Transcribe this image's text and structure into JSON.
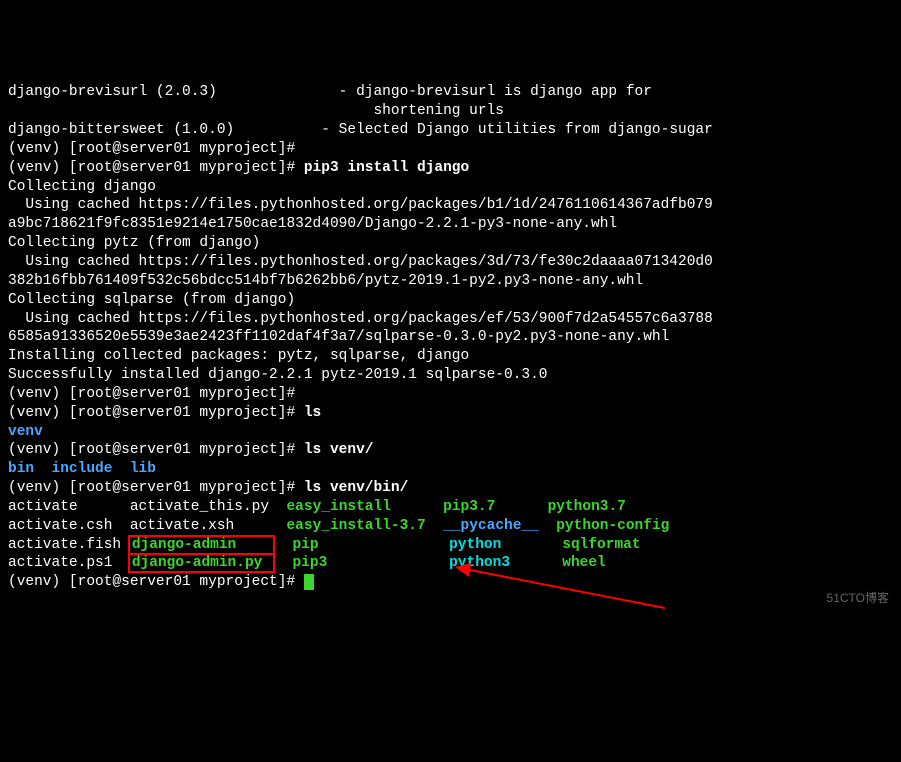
{
  "lines": {
    "l1_a": "django-brevisurl (2.0.3)",
    "l1_b": "- django-brevisurl is django app for",
    "l2": "                                          shortening urls",
    "l3_a": "django-bittersweet (1.0.0)",
    "l3_b": "- Selected Django utilities from django-sugar",
    "l4": "(venv) [root@server01 myproject]#",
    "l5_p": "(venv) [root@server01 myproject]# ",
    "l5_c": "pip3 install django",
    "l6": "Collecting django",
    "l7": "  Using cached https://files.pythonhosted.org/packages/b1/1d/2476110614367adfb079",
    "l8": "a9bc718621f9fc8351e9214e1750cae1832d4090/Django-2.2.1-py3-none-any.whl",
    "l9": "Collecting pytz (from django)",
    "l10": "  Using cached https://files.pythonhosted.org/packages/3d/73/fe30c2daaaa0713420d0",
    "l11": "382b16fbb761409f532c56bdcc514bf7b6262bb6/pytz-2019.1-py2.py3-none-any.whl",
    "l12": "Collecting sqlparse (from django)",
    "l13": "  Using cached https://files.pythonhosted.org/packages/ef/53/900f7d2a54557c6a3788",
    "l14": "6585a91336520e5539e3ae2423ff1102daf4f3a7/sqlparse-0.3.0-py2.py3-none-any.whl",
    "l15": "Installing collected packages: pytz, sqlparse, django",
    "l16": "Successfully installed django-2.2.1 pytz-2019.1 sqlparse-0.3.0",
    "l17": "(venv) [root@server01 myproject]#",
    "l18_p": "(venv) [root@server01 myproject]# ",
    "l18_c": "ls",
    "l19": "venv",
    "l20_p": "(venv) [root@server01 myproject]# ",
    "l20_c": "ls venv/",
    "l21_a": "bin",
    "l21_b": "include",
    "l21_c": "lib",
    "l22_p": "(venv) [root@server01 myproject]# ",
    "l22_c": "ls venv/bin/",
    "tbl": {
      "r1c1": "activate",
      "r1c2": "activate_this.py",
      "r1c3": "easy_install",
      "r1c4": "pip3.7",
      "r1c5": "python3.7",
      "r2c1": "activate.csh",
      "r2c2": "activate.xsh",
      "r2c3": "easy_install-3.7",
      "r2c4": "__pycache__",
      "r2c5": "python-config",
      "r3c1": "activate.fish",
      "r3c2": "django-admin",
      "r3c3": "pip",
      "r3c4": "python",
      "r3c5": "sqlformat",
      "r4c1": "activate.ps1",
      "r4c2": "django-admin.py",
      "r4c3": "pip3",
      "r4c4": "python3",
      "r4c5": "wheel"
    },
    "l27": "(venv) [root@server01 myproject]# "
  },
  "watermark": "51CTO博客"
}
